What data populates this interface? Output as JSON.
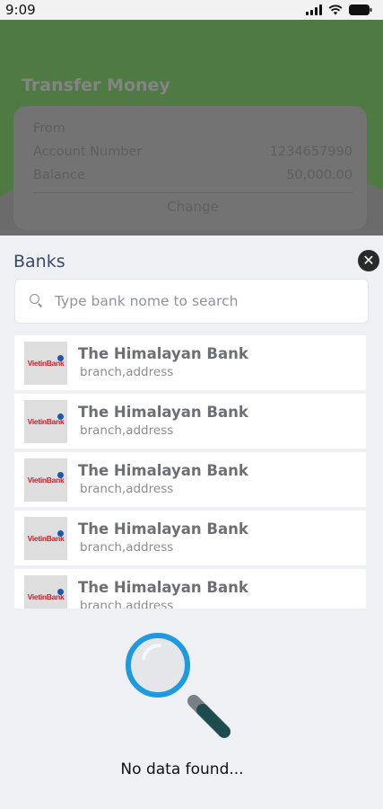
{
  "status": {
    "time": "9:09"
  },
  "background": {
    "title": "Transfer Money",
    "from_label": "From",
    "account_label": "Account Number",
    "account_value": "1234657990",
    "balance_label": "Balance",
    "balance_value": "50,000.00",
    "change_label": "Change"
  },
  "sheet": {
    "title": "Banks",
    "close_icon": "close-icon",
    "search": {
      "placeholder": "Type bank nome to search",
      "value": ""
    },
    "banks": [
      {
        "name": "The Himalayan Bank",
        "address": "branch,address",
        "logo_text": "VietinBank"
      },
      {
        "name": "The Himalayan Bank",
        "address": "branch,address",
        "logo_text": "VietinBank"
      },
      {
        "name": "The Himalayan Bank",
        "address": "branch,address",
        "logo_text": "VietinBank"
      },
      {
        "name": "The Himalayan Bank",
        "address": "branch,address",
        "logo_text": "VietinBank"
      },
      {
        "name": "The Himalayan Bank",
        "address": "branch,address",
        "logo_text": "VietinBank"
      }
    ],
    "empty_text": "No data found..."
  },
  "colors": {
    "header_green": "#2f7d1b",
    "accent_blue": "#1e9be0"
  }
}
